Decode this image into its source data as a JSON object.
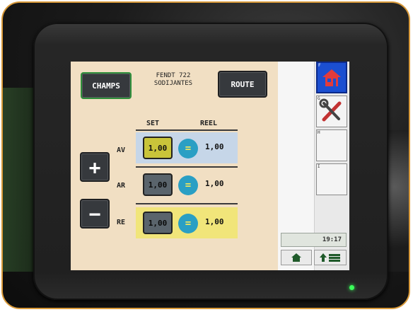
{
  "screen": {
    "champs_label": "CHAMPS",
    "route_label": "ROUTE",
    "title_line1": "FENDT 722",
    "title_line2": "SODIJANTES"
  },
  "table": {
    "header_set": "SET",
    "header_reel": "REEL",
    "rows": [
      {
        "label": "AV",
        "set": "1,00",
        "equals": "=",
        "reel": "1,00"
      },
      {
        "label": "AR",
        "set": "1,00",
        "equals": "=",
        "reel": "1,00"
      },
      {
        "label": "RE",
        "set": "1,00",
        "equals": "=",
        "reel": "1,00"
      }
    ]
  },
  "controls": {
    "plus_label": "+",
    "minus_label": "−"
  },
  "softkeys": {
    "labels": [
      "F",
      "G",
      "H",
      "I"
    ],
    "icons": [
      "home-icon",
      "tools-icon",
      "",
      ""
    ]
  },
  "status": {
    "clock": "19:17"
  },
  "colors": {
    "screen_bg": "#f1dfc3",
    "row_av": "#c6d6e8",
    "row_re": "#f1e57a",
    "equals_circle": "#2a9fc4",
    "home_softkey": "#1b4fd1",
    "frame_border": "#d99a3a",
    "led": "#3bff5a"
  }
}
